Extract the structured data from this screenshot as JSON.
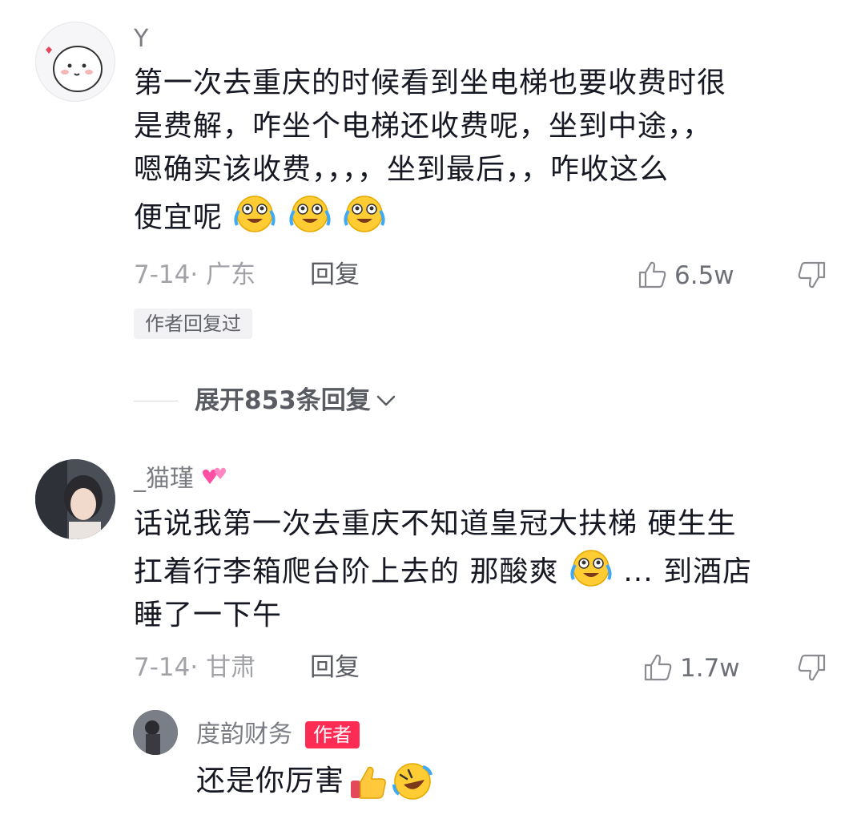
{
  "comments": [
    {
      "username": "Y",
      "text_lines": [
        "第一次去重庆的时候看到坐电梯也要收费时很",
        "是费解，咋坐个电梯还收费呢，坐到中途，，",
        "嗯确实该收费，，，，坐到最后，，咋收这么",
        "便宜呢"
      ],
      "meta": "7-14· 广东",
      "reply_label": "回复",
      "like_count": "6.5w",
      "badge": "作者回复过",
      "trailing_emojis": [
        "cry-laugh-emoji",
        "cry-laugh-emoji",
        "cry-laugh-emoji"
      ]
    },
    {
      "username": "_猫瑾",
      "text_lines": [
        "话说我第一次去重庆不知道皇冠大扶梯 硬生生",
        "扛着行李箱爬台阶上去的   那酸爽",
        "... 到酒店",
        "睡了一下午"
      ],
      "meta": "7-14· 甘肃",
      "reply_label": "回复",
      "like_count": "1.7w"
    }
  ],
  "expand": {
    "label": "展开853条回复"
  },
  "reply": {
    "username": "度韵财务",
    "author_tag": "作者",
    "text": "还是你厉害"
  },
  "icons": {
    "like": "thumbs-up-outline-icon",
    "dislike": "thumbs-down-outline-icon",
    "chevron": "chevron-down-icon",
    "hearts": "two-hearts-emoji",
    "thumbs_emoji": "thumbs-up-emoji",
    "rofl_emoji": "rolling-laugh-emoji"
  },
  "colors": {
    "author_tag": "#fe2c55",
    "text": "#161823",
    "meta": "#a2a3a8"
  }
}
